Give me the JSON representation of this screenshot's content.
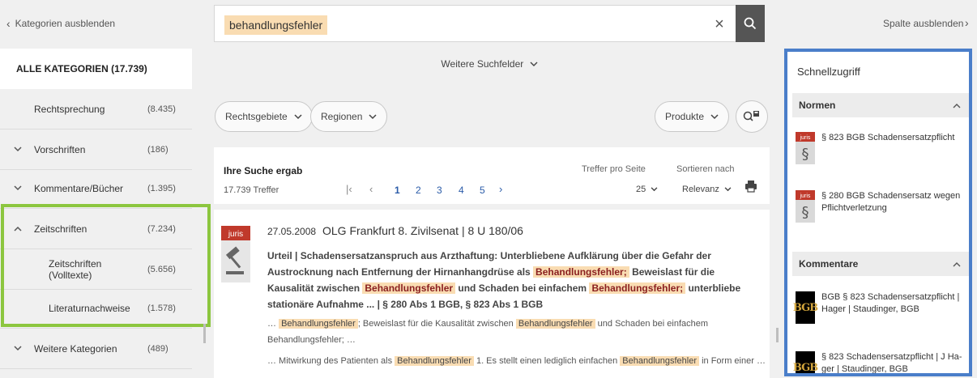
{
  "sidebar": {
    "hide_label": "Kategorien ausblenden",
    "all_categories": "ALLE KATEGORIEN (17.739)",
    "items": [
      {
        "label": "Rechtsprechung",
        "count": "(8.435)",
        "chevron": ""
      },
      {
        "label": "Vorschriften",
        "count": "(186)",
        "chevron": "down"
      },
      {
        "label": "Kommentare/Bücher",
        "count": "(1.395)",
        "chevron": "down"
      },
      {
        "label": "Zeitschriften",
        "count": "(7.234)",
        "chevron": "up"
      },
      {
        "label": "Zeitschriften (Volltexte)",
        "count": "(5.656)",
        "chevron": ""
      },
      {
        "label": "Literaturnachweise",
        "count": "(1.578)",
        "chevron": ""
      },
      {
        "label": "Weitere Kategorien",
        "count": "(489)",
        "chevron": "down"
      }
    ]
  },
  "search": {
    "term": "behandlungsfehler",
    "clear_icon": "close-icon",
    "search_icon": "search-icon"
  },
  "filters": {
    "more_fields": "Weitere Suchfelder",
    "rechtsgebiete": "Rechtsgebiete",
    "regionen": "Regionen",
    "produkte": "Produkte"
  },
  "results": {
    "title": "Ihre Suche ergab",
    "count": "17.739 Treffer",
    "pages": [
      "1",
      "2",
      "3",
      "4",
      "5"
    ],
    "per_page_label": "Treffer pro Seite",
    "per_page_value": "25",
    "sort_label": "Sortieren nach",
    "sort_value": "Relevanz"
  },
  "result_item": {
    "badge": "juris",
    "date": "27.05.2008",
    "court": "OLG Frankfurt 8. Zivilsenat | 8 U 180/06",
    "body_1": "Urteil | Schadensersatzanspruch aus Arzthaftung: Unterbliebene Aufklärung über die Gefahr der Austrocknung nach Entfernung der Hirnanhangdrüse als ",
    "hl_1": "Behandlungsfehler;",
    "body_2": " Beweislast für die Kausalität zwischen ",
    "hl_2": "Behandlungsfehler",
    "body_3": " und Schaden bei einfachem ",
    "hl_3": "Behandlungsfehler;",
    "body_4": " unterbliebe stationäre Aufnahme ... | § 280 Abs 1 BGB, § 823 Abs 1 BGB",
    "snip1_a": "… ",
    "snip1_hl1": "Behandlungsfehler",
    "snip1_b": "; Beweislast für die Kausalität zwischen ",
    "snip1_hl2": "Behandlungsfehler",
    "snip1_c": " und Schaden bei einfachem Behandlungsfehler; …",
    "snip2_a": "… Mitwirkung des Patienten als ",
    "snip2_hl1": "Behandlungsfehler",
    "snip2_b": " 1. Es stellt einen lediglich einfachen ",
    "snip2_hl2": "Behandlungsfehler",
    "snip2_c": " in Form einer …"
  },
  "right": {
    "hide_label": "Spalte ausblenden",
    "quick_title": "Schnellzugriff",
    "normen_header": "Normen",
    "normen": [
      {
        "badge": "juris",
        "text": "§ 823 BGB Schadensersatzpflicht"
      },
      {
        "badge": "juris",
        "text": "§ 280 BGB Schadensersatz wegen Pflichtverletzung"
      }
    ],
    "kommentare_header": "Kommentare",
    "kommentare": [
      {
        "badge": "BGB",
        "text": "BGB § 823 Schadensersatzpflicht | Hager | Staudinger, BGB"
      },
      {
        "badge": "BGB",
        "text": "§ 823 Schadensersatzpflicht | J Ha­ger | Staudinger, BGB"
      }
    ]
  },
  "colors": {
    "highlight": "#f9dcb2",
    "green_frame": "#8cc63f",
    "blue_frame": "#4a7ec9",
    "juris_red": "#c0392b"
  }
}
